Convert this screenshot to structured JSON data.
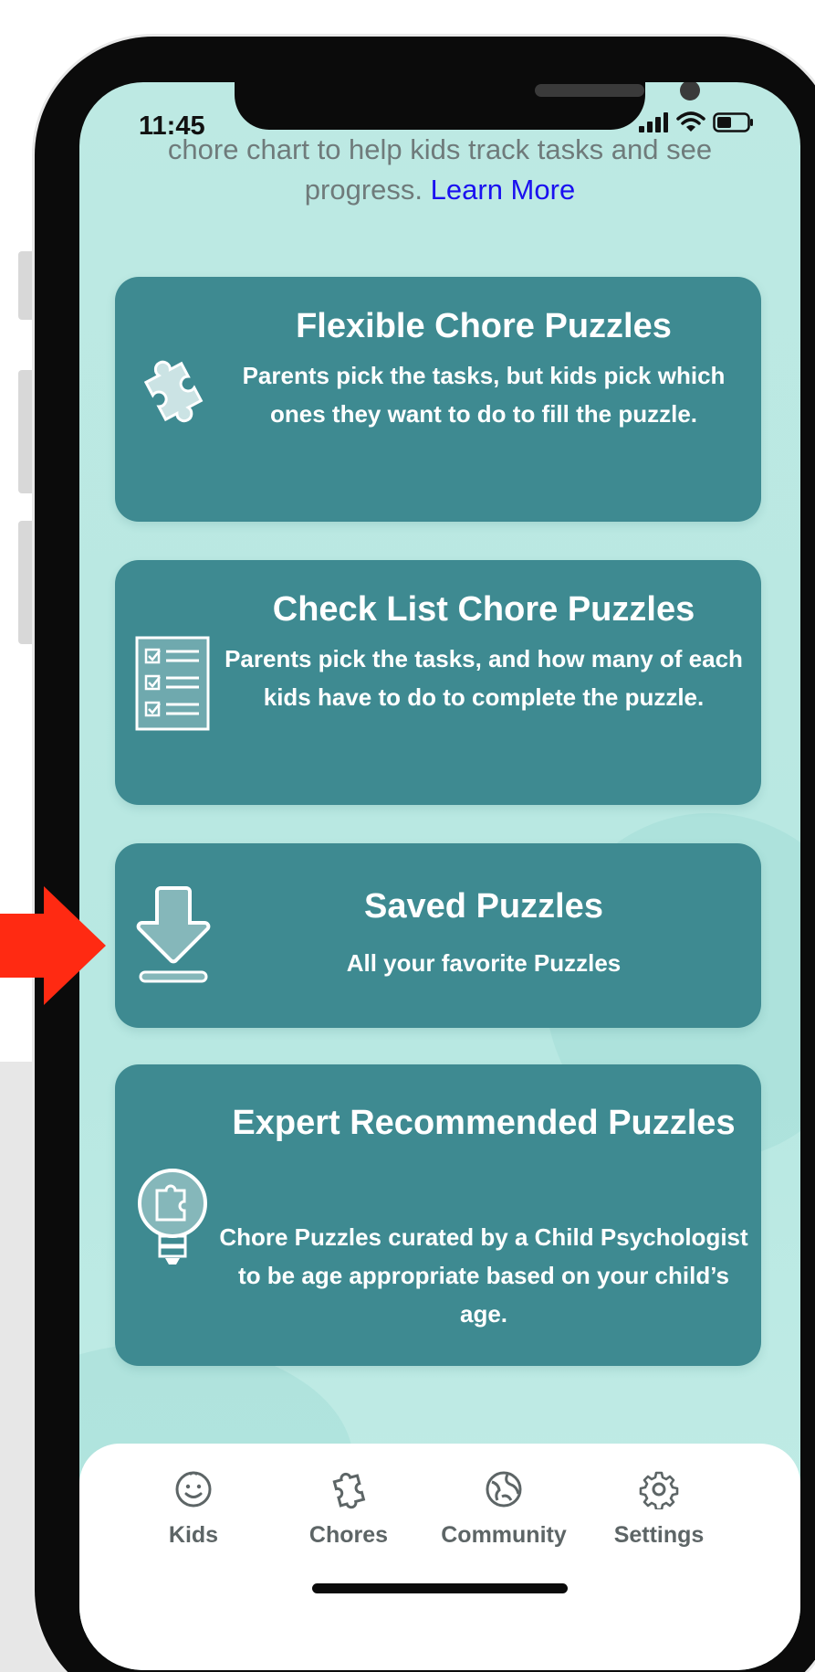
{
  "status_bar": {
    "time": "11:45"
  },
  "intro": {
    "text": "chore chart to help kids track tasks and see progress.",
    "link": "Learn More"
  },
  "cards": [
    {
      "title": "Flexible Chore Puzzles",
      "description": "Parents pick the tasks, but kids pick which ones they want to do to fill the puzzle.",
      "icon": "puzzle-piece-icon"
    },
    {
      "title": "Check List Chore Puzzles",
      "description": "Parents pick the tasks, and how many of each kids have to do to complete the puzzle.",
      "icon": "checklist-icon"
    },
    {
      "title": "Saved Puzzles",
      "description": "All your favorite Puzzles",
      "icon": "download-arrow-icon"
    },
    {
      "title": "Expert Recommended Puzzles",
      "description": "Chore Puzzles curated by a Child Psychologist to be age appropriate based on your child’s age.",
      "icon": "lightbulb-puzzle-icon"
    }
  ],
  "tabbar": {
    "tabs": [
      {
        "label": "Kids",
        "icon": "smiley-face-icon"
      },
      {
        "label": "Chores",
        "icon": "puzzle-piece-icon"
      },
      {
        "label": "Community",
        "icon": "globe-icon"
      },
      {
        "label": "Settings",
        "icon": "gear-icon"
      }
    ]
  },
  "colors": {
    "card": "#3e8a91",
    "background": "#bde9e3",
    "link": "#1a10f0",
    "annotation_arrow": "#ff2a12"
  }
}
